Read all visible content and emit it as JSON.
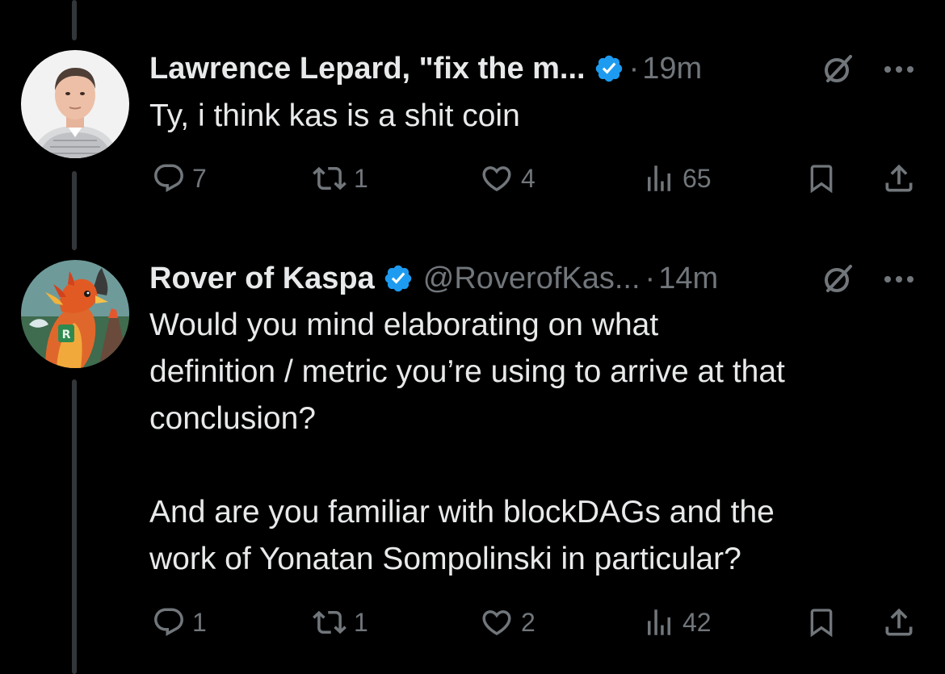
{
  "colors": {
    "background": "#000000",
    "primary_text": "#e7e9ea",
    "secondary_text": "#71767b",
    "verified_badge": "#1d9bf0",
    "thread_line": "#333639"
  },
  "tweets": [
    {
      "display_name": "Lawrence Lepard, \"fix the m...",
      "handle": "",
      "separator": "·",
      "time": "19m",
      "verified_icon": "verified-badge-icon",
      "text": "Ty, i think kas is a shit coin",
      "actions": {
        "replies": "7",
        "reposts": "1",
        "likes": "4",
        "views": "65"
      }
    },
    {
      "display_name": "Rover of Kaspa",
      "handle": "@RoverofKas...",
      "separator": "·",
      "time": "14m",
      "verified_icon": "verified-badge-icon",
      "text": "Would you mind elaborating on what\ndefinition / metric you’re using to arrive at that\nconclusion?\n\nAnd are you familiar with blockDAGs and the\nwork of Yonatan Sompolinski in particular?",
      "actions": {
        "replies": "1",
        "reposts": "1",
        "likes": "2",
        "views": "42"
      }
    }
  ]
}
